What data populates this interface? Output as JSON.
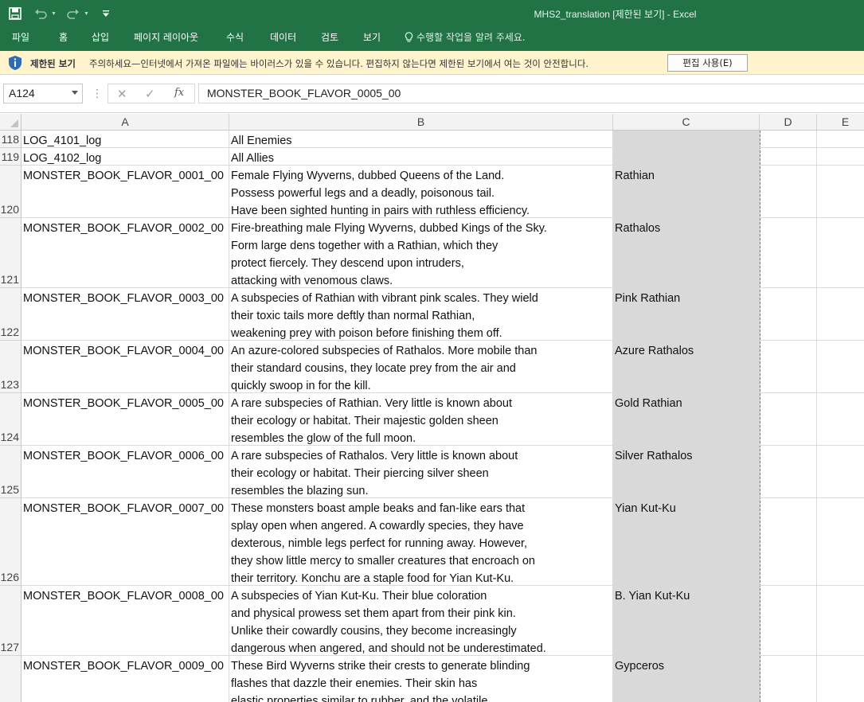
{
  "app": {
    "window_title": "MHS2_translation  [제한된 보기] - Excel"
  },
  "ribbon": {
    "tabs": [
      "파일",
      "홈",
      "삽입",
      "페이지 레이아웃",
      "수식",
      "데이터",
      "검토",
      "보기"
    ],
    "tell_me": "수행할 작업을 알려 주세요."
  },
  "message_bar": {
    "title": "제한된 보기",
    "text": "주의하세요—인터넷에서 가져온 파일에는 바이러스가 있을 수 있습니다. 편집하지 않는다면 제한된 보기에서 여는 것이 안전합니다.",
    "button_label": "편집 사용(E)"
  },
  "formula_bar": {
    "name_box": "A124",
    "formula": "MONSTER_BOOK_FLAVOR_0005_00",
    "fx_label": "fx"
  },
  "columns": [
    "A",
    "B",
    "C",
    "D",
    "E"
  ],
  "rows": [
    {
      "num": "118",
      "a": "LOG_4101_log",
      "b": "All Enemies",
      "c": ""
    },
    {
      "num": "119",
      "a": "LOG_4102_log",
      "b": "All Allies",
      "c": ""
    },
    {
      "num": "120",
      "a": "MONSTER_BOOK_FLAVOR_0001_00",
      "b": "Female Flying Wyverns, dubbed Queens of the Land.\nPossess powerful legs and a deadly, poisonous tail.\nHave been sighted hunting in pairs with ruthless efficiency.",
      "c": "Rathian"
    },
    {
      "num": "121",
      "a": "MONSTER_BOOK_FLAVOR_0002_00",
      "b": "Fire-breathing male Flying Wyverns, dubbed Kings of the Sky.\nForm large dens together with a Rathian, which they\nprotect fiercely. They descend upon intruders,\nattacking with venomous claws.",
      "c": "Rathalos"
    },
    {
      "num": "122",
      "a": "MONSTER_BOOK_FLAVOR_0003_00",
      "b": "A subspecies of Rathian with vibrant pink scales. They wield\ntheir toxic tails more deftly than normal Rathian,\nweakening prey with poison before finishing them off.",
      "c": "Pink Rathian"
    },
    {
      "num": "123",
      "a": "MONSTER_BOOK_FLAVOR_0004_00",
      "b": "An azure-colored subspecies of Rathalos. More mobile than\ntheir standard cousins, they locate prey from the air and\nquickly swoop in for the kill.",
      "c": "Azure Rathalos"
    },
    {
      "num": "124",
      "a": "MONSTER_BOOK_FLAVOR_0005_00",
      "b": "A rare subspecies of Rathian. Very little is known about\ntheir ecology or habitat. Their majestic golden sheen\nresembles the glow of the full moon.",
      "c": "Gold Rathian"
    },
    {
      "num": "125",
      "a": "MONSTER_BOOK_FLAVOR_0006_00",
      "b": "A rare subspecies of Rathalos. Very little is known about\ntheir ecology or habitat. Their piercing silver sheen\nresembles the blazing sun.",
      "c": "Silver Rathalos"
    },
    {
      "num": "126",
      "a": "MONSTER_BOOK_FLAVOR_0007_00",
      "b": "These monsters boast ample beaks and fan-like ears that\nsplay open when angered. A cowardly species, they have\ndexterous, nimble legs perfect for running away. However,\nthey show little mercy to smaller creatures that encroach on\ntheir territory. Konchu are a staple food for Yian Kut-Ku.",
      "c": "Yian Kut-Ku"
    },
    {
      "num": "127",
      "a": "MONSTER_BOOK_FLAVOR_0008_00",
      "b": "A subspecies of Yian Kut-Ku. Their blue coloration\nand physical prowess set them apart from their pink kin.\nUnlike their cowardly cousins, they become increasingly\ndangerous when angered, and should not be underestimated.",
      "c": "B. Yian Kut-Ku"
    },
    {
      "num": "",
      "a": "MONSTER_BOOK_FLAVOR_0009_00",
      "b": "These Bird Wyverns strike their crests to generate blinding\nflashes that dazzle their enemies. Their skin has\nelastic properties similar to rubber, and the volatile",
      "c": "Gypceros"
    }
  ],
  "colors": {
    "excel_green": "#217346",
    "message_bar": "#fff4ce",
    "column_c_fill": "#d9d9d9"
  }
}
